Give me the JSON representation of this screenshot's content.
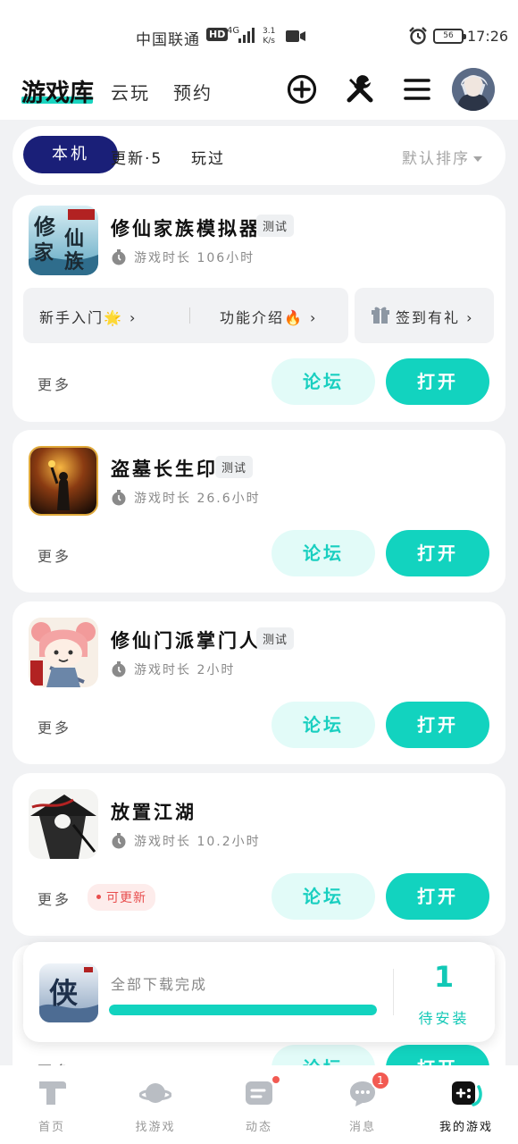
{
  "status_bar": {
    "carrier": "中国联通",
    "hd": "HD",
    "network": "4G",
    "speed_value": "3.1",
    "speed_unit": "K/s",
    "battery": "56",
    "time": "17:26"
  },
  "header": {
    "brand": "游戏库",
    "tabs": [
      "云玩",
      "预约"
    ],
    "accent_color": "#19d4c0"
  },
  "filter": {
    "tabs": [
      "本机",
      "更新·5",
      "玩过"
    ],
    "active_tab": "本机",
    "sort_label": "默认排序"
  },
  "games": [
    {
      "title": "修仙家族模拟器",
      "tag": "测试",
      "playtime": "游戏时长 106小时",
      "guides": [
        "新手入门🌟 ›",
        "功能介绍🔥 ›"
      ],
      "gift": "签到有礼 ›",
      "more": "更多",
      "forum": "论坛",
      "open": "打开"
    },
    {
      "title": "盗墓长生印",
      "tag": "测试",
      "playtime": "游戏时长 26.6小时",
      "more": "更多",
      "forum": "论坛",
      "open": "打开"
    },
    {
      "title": "修仙门派掌门人",
      "tag": "测试",
      "playtime": "游戏时长 2小时",
      "more": "更多",
      "forum": "论坛",
      "open": "打开"
    },
    {
      "title": "放置江湖",
      "playtime": "游戏时长 10.2小时",
      "more": "更多",
      "update_badge": "可更新",
      "forum": "论坛",
      "open": "打开"
    }
  ],
  "partial_card": {
    "more": "更多",
    "forum": "论坛",
    "open": "打开"
  },
  "download": {
    "status": "全部下载完成",
    "progress": 1.0,
    "count": "1",
    "count_label": "待安装"
  },
  "bottom_nav": {
    "items": [
      "首页",
      "找游戏",
      "动态",
      "消息",
      "我的游戏"
    ],
    "active": "我的游戏",
    "message_badge": "1"
  }
}
